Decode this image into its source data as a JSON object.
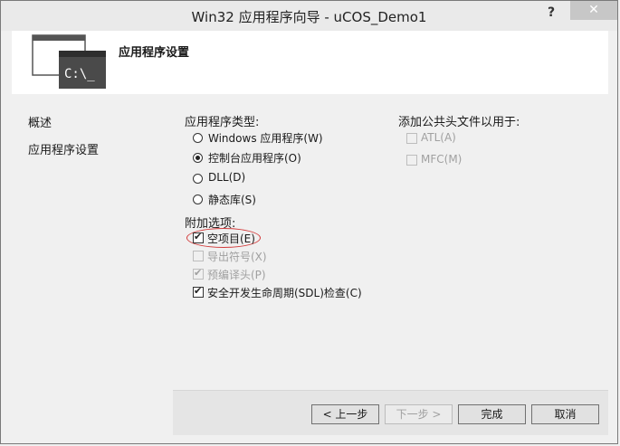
{
  "window": {
    "title": "Win32 应用程序向导 - uCOS_Demo1",
    "help_label": "?",
    "close_label": "✕"
  },
  "header": {
    "title": "应用程序设置",
    "icon_label": "C:\\_"
  },
  "nav": {
    "items": [
      {
        "label": "概述"
      },
      {
        "label": "应用程序设置"
      }
    ]
  },
  "app_type": {
    "label": "应用程序类型:",
    "options": [
      {
        "label": "Windows 应用程序(W)",
        "selected": false
      },
      {
        "label": "控制台应用程序(O)",
        "selected": true
      },
      {
        "label": "DLL(D)",
        "selected": false
      },
      {
        "label": "静态库(S)",
        "selected": false
      }
    ]
  },
  "extra": {
    "label": "附加选项:",
    "options": [
      {
        "label": "空项目(E)",
        "checked": true,
        "enabled": true
      },
      {
        "label": "导出符号(X)",
        "checked": false,
        "enabled": false
      },
      {
        "label": "预编译头(P)",
        "checked": true,
        "enabled": false
      },
      {
        "label": "安全开发生命周期(SDL)检查(C)",
        "checked": true,
        "enabled": true
      }
    ]
  },
  "common_headers": {
    "label": "添加公共头文件以用于:",
    "options": [
      {
        "label": "ATL(A)",
        "checked": false,
        "enabled": false
      },
      {
        "label": "MFC(M)",
        "checked": false,
        "enabled": false
      }
    ]
  },
  "buttons": {
    "prev": "< 上一步",
    "next": "下一步 >",
    "finish": "完成",
    "cancel": "取消"
  },
  "colors": {
    "highlight_ellipse": "#d23a3a",
    "close_button": "#c7c7c7"
  }
}
